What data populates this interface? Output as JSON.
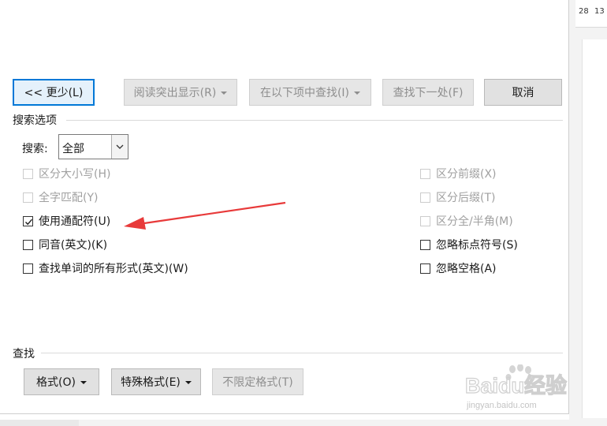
{
  "background": {
    "ruler_numbers": [
      "28",
      "13"
    ]
  },
  "toolbar": {
    "less_label": "<< 更少(L)",
    "highlight_label": "阅读突出显示(R)",
    "find_in_label": "在以下项中查找(I)",
    "find_next_label": "查找下一处(F)",
    "cancel_label": "取消"
  },
  "search_options": {
    "title": "搜索选项",
    "search_label": "搜索:",
    "search_value": "全部",
    "left_options": [
      {
        "label": "区分大小写(H)",
        "checked": false,
        "enabled": false
      },
      {
        "label": "全字匹配(Y)",
        "checked": false,
        "enabled": false
      },
      {
        "label": "使用通配符(U)",
        "checked": true,
        "enabled": true
      },
      {
        "label": "同音(英文)(K)",
        "checked": false,
        "enabled": true
      },
      {
        "label": "查找单词的所有形式(英文)(W)",
        "checked": false,
        "enabled": true
      }
    ],
    "right_options": [
      {
        "label": "区分前缀(X)",
        "checked": false,
        "enabled": false
      },
      {
        "label": "区分后缀(T)",
        "checked": false,
        "enabled": false
      },
      {
        "label": "区分全/半角(M)",
        "checked": false,
        "enabled": false
      },
      {
        "label": "忽略标点符号(S)",
        "checked": false,
        "enabled": true
      },
      {
        "label": "忽略空格(A)",
        "checked": false,
        "enabled": true
      }
    ]
  },
  "find": {
    "title": "查找",
    "format_label": "格式(O)",
    "special_label": "特殊格式(E)",
    "no_format_label": "不限定格式(T)"
  },
  "watermark": {
    "brand": "Baidu经验",
    "url": "jingyan.baidu.com"
  },
  "colors": {
    "accent": "#0078d7",
    "annotation_arrow": "#e83a3a"
  }
}
